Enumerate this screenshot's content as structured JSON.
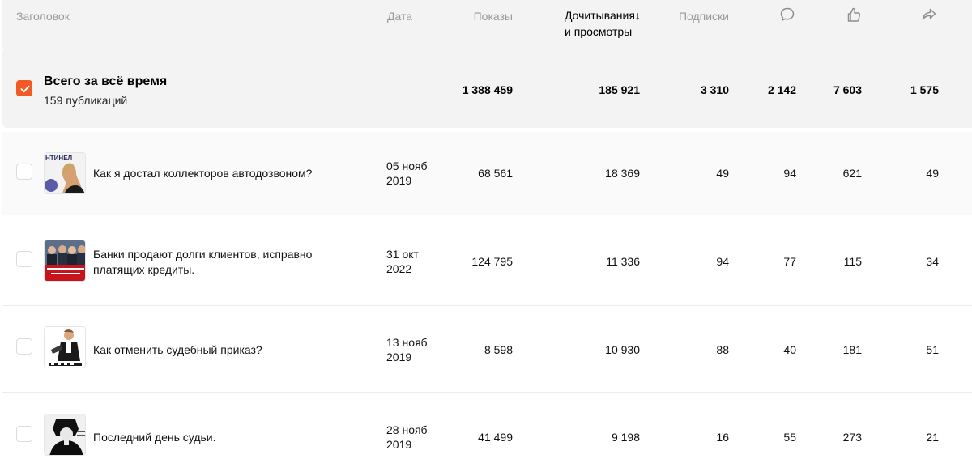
{
  "header": {
    "title": "Заголовок",
    "date": "Дата",
    "views": "Показы",
    "reads_line1": "Дочитывания",
    "reads_arrow": "↓",
    "reads_line2": "и просмотры",
    "subs": "Подписки",
    "icons": [
      "comment-icon",
      "like-icon",
      "share-icon"
    ]
  },
  "total": {
    "title": "Всего за всё время",
    "subtitle": "159 публикаций",
    "checked": true,
    "views": "1 388 459",
    "reads": "185 921",
    "subs": "3 310",
    "comments": "2 142",
    "likes": "7 603",
    "shares": "1 575"
  },
  "rows": [
    {
      "title_line1": "Как я достал коллекторов автодозвоном?",
      "title_line2": "",
      "date_line1": "05 нояб",
      "date_line2": "2019",
      "views": "68 561",
      "reads": "18 369",
      "subs": "49",
      "comments": "94",
      "likes": "621",
      "shares": "49",
      "thumb_text": "НТИНЕЛ"
    },
    {
      "title_line1": "Банки продают долги клиентов, исправно",
      "title_line2": "платящих кредиты.",
      "date_line1": "31 окт",
      "date_line2": "2022",
      "views": "124 795",
      "reads": "11 336",
      "subs": "94",
      "comments": "77",
      "likes": "115",
      "shares": "34",
      "thumb_text": ""
    },
    {
      "title_line1": "Как отменить судебный приказ?",
      "title_line2": "",
      "date_line1": "13 нояб",
      "date_line2": "2019",
      "views": "8 598",
      "reads": "10 930",
      "subs": "88",
      "comments": "40",
      "likes": "181",
      "shares": "51",
      "thumb_text": ""
    },
    {
      "title_line1": "Последний день судьи.",
      "title_line2": "",
      "date_line1": "28 нояб",
      "date_line2": "2019",
      "views": "41 499",
      "reads": "9 198",
      "subs": "16",
      "comments": "55",
      "likes": "273",
      "shares": "21",
      "thumb_text": ""
    }
  ],
  "colors": {
    "accent": "#f15a24",
    "header_bg": "#f3f3f3",
    "muted_text": "#9a9a9a"
  }
}
